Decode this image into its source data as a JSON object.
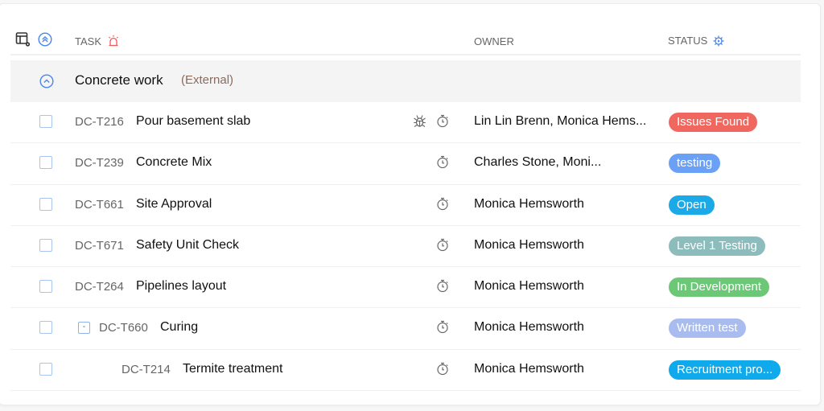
{
  "header": {
    "task_label": "TASK",
    "owner_label": "OWNER",
    "status_label": "STATUS"
  },
  "group": {
    "name": "Concrete work",
    "tag": "(External)"
  },
  "rows": [
    {
      "id": "DC-T216",
      "name": "Pour basement slab",
      "bug": true,
      "owner": "Lin Lin Brenn, Monica Hems...",
      "status": "Issues Found",
      "color": "#f0675f",
      "level": 0
    },
    {
      "id": "DC-T239",
      "name": "Concrete Mix",
      "bug": false,
      "owner": "Charles Stone, Moni...",
      "status": "testing",
      "color": "#6aa0f5",
      "level": 0
    },
    {
      "id": "DC-T661",
      "name": "Site Approval",
      "bug": false,
      "owner": "Monica Hemsworth",
      "status": "Open",
      "color": "#1ba9e8",
      "level": 0
    },
    {
      "id": "DC-T671",
      "name": "Safety Unit Check",
      "bug": false,
      "owner": "Monica Hemsworth",
      "status": "Level 1 Testing",
      "color": "#8cbcbc",
      "level": 0
    },
    {
      "id": "DC-T264",
      "name": "Pipelines layout",
      "bug": false,
      "owner": "Monica Hemsworth",
      "status": "In Development",
      "color": "#6cc776",
      "level": 0
    },
    {
      "id": "DC-T660",
      "name": "Curing",
      "bug": false,
      "owner": "Monica Hemsworth",
      "status": "Written test",
      "color": "#a9bcef",
      "level": 0,
      "expandable": true,
      "expand_symbol": "-"
    },
    {
      "id": "DC-T214",
      "name": "Termite treatment",
      "bug": false,
      "owner": "Monica Hemsworth",
      "status": "Recruitment pro...",
      "color": "#0eaaeb",
      "level": 1
    }
  ],
  "colors": {
    "accent": "#4a86e8",
    "alarm": "#f05a5a"
  }
}
